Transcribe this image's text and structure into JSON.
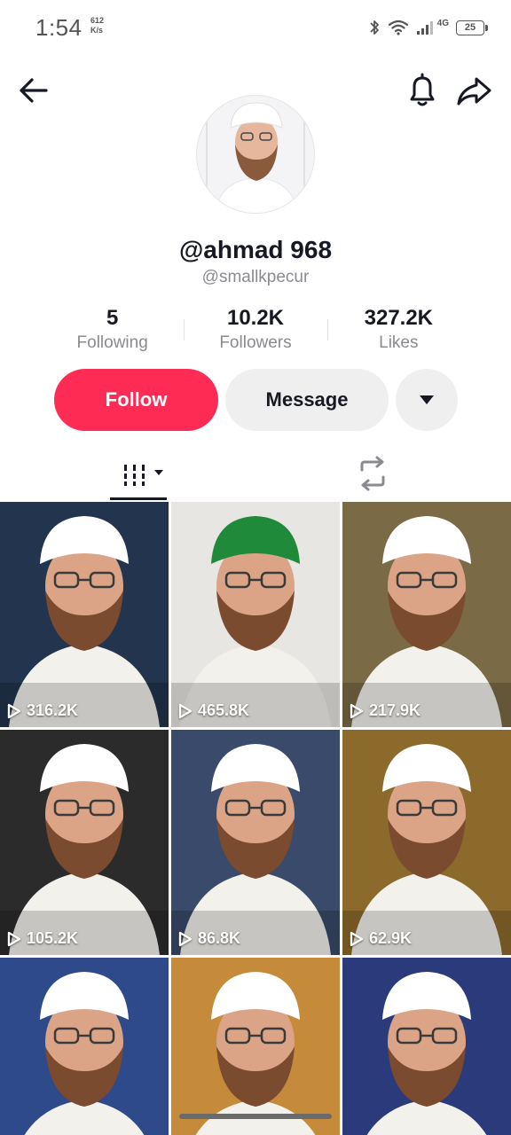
{
  "status_bar": {
    "time": "1:54",
    "net_speed_value": "612",
    "net_speed_unit": "K/s",
    "network_type": "4G",
    "battery": "25",
    "icons": [
      "bluetooth-icon",
      "wifi-icon",
      "signal-icon",
      "battery-icon"
    ]
  },
  "nav": {
    "icons": [
      "back-arrow-icon",
      "bell-icon",
      "share-icon"
    ]
  },
  "profile": {
    "display_name": "@ahmad 968",
    "username": "@smallkpecur"
  },
  "stats": [
    {
      "value": "5",
      "label": "Following"
    },
    {
      "value": "10.2K",
      "label": "Followers"
    },
    {
      "value": "327.2K",
      "label": "Likes"
    }
  ],
  "actions": {
    "follow_label": "Follow",
    "message_label": "Message",
    "more_icon": "caret-down-icon"
  },
  "tabs": {
    "active": "videos",
    "icons": [
      "videos-grid-icon",
      "repost-icon"
    ]
  },
  "colors": {
    "accent": "#fe2c55",
    "text_primary": "#161823",
    "text_secondary": "#8a8b91",
    "button_gray": "#efeff0"
  },
  "videos": [
    {
      "views": "316.2K"
    },
    {
      "views": "465.8K"
    },
    {
      "views": "217.9K"
    },
    {
      "views": "105.2K"
    },
    {
      "views": "86.8K"
    },
    {
      "views": "62.9K"
    },
    {
      "views": ""
    },
    {
      "views": ""
    },
    {
      "views": ""
    }
  ]
}
